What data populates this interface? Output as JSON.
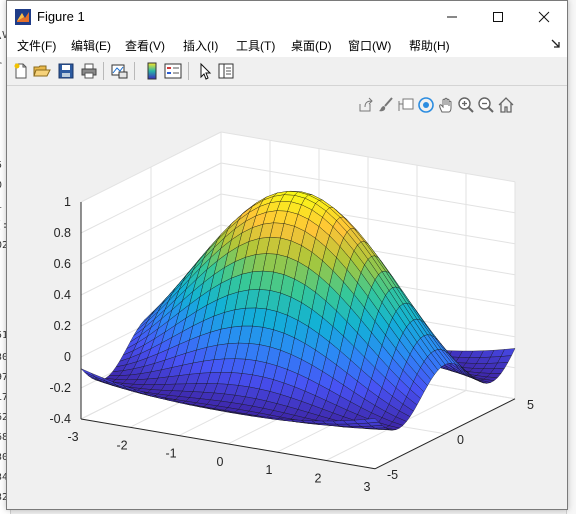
{
  "window": {
    "title": "Figure 1",
    "controls": [
      "minimize",
      "maximize",
      "close"
    ]
  },
  "menu": [
    "文件(F)",
    "编辑(E)",
    "查看(V)",
    "插入(I)",
    "工具(T)",
    "桌面(D)",
    "窗口(W)",
    "帮助(H)"
  ],
  "toolbar_icons": [
    "new-figure-icon",
    "open-file-icon",
    "save-icon",
    "print-icon",
    "link-plot-icon",
    "colorbar-icon",
    "legend-icon",
    "edit-plot-arrow-icon",
    "property-inspector-icon"
  ],
  "axes_toolbar_icons": [
    "export-icon",
    "brush-icon",
    "data-tips-icon",
    "rotate-3d-icon",
    "pan-icon",
    "zoom-in-icon",
    "zoom-out-icon",
    "home-icon"
  ],
  "chart_data": {
    "type": "surface",
    "function": "sin(sqrt(x^2+y^2)) / sqrt(x^2+y^2)",
    "colormap": "parula",
    "grid": true,
    "xlim": [
      -3,
      3
    ],
    "ylim": [
      -5,
      5
    ],
    "zlim": [
      -0.4,
      1
    ],
    "xticks": [
      "-3",
      "-2",
      "-1",
      "0",
      "1",
      "2",
      "3"
    ],
    "yticks": [
      "-5",
      "0",
      "5"
    ],
    "zticks": [
      "-0.4",
      "-0.2",
      "0",
      "0.2",
      "0.4",
      "0.6",
      "0.8",
      "1"
    ]
  },
  "background_text": [
    "\\V",
    "r",
    ":",
    "5",
    "0",
    "i",
    "(:",
    "02",
    "51",
    "30",
    "97",
    "17",
    "62",
    "68",
    "30",
    "34",
    "32"
  ]
}
